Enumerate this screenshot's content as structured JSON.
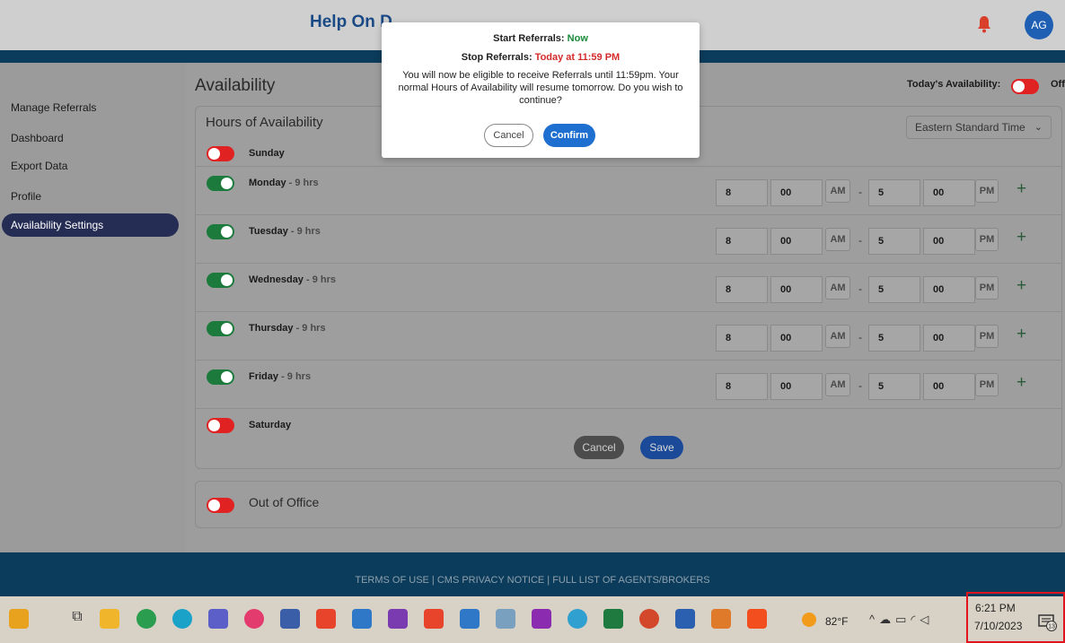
{
  "header": {
    "brand": "Help On D",
    "avatar_initials": "AG"
  },
  "sidebar": {
    "items": [
      {
        "label": "Manage Referrals"
      },
      {
        "label": "Dashboard"
      },
      {
        "label": "Export Data"
      },
      {
        "label": "Profile"
      },
      {
        "label": "Availability Settings"
      }
    ]
  },
  "main": {
    "title": "Availability",
    "today_label": "Today's Availability:",
    "today_state": "Off",
    "card_title": "Hours of Availability",
    "timezone": "Eastern Standard Time",
    "days": [
      {
        "name": "Sunday",
        "hrs": "",
        "enabled": false
      },
      {
        "name": "Monday",
        "hrs": " - 9 hrs",
        "enabled": true,
        "start_h": "8",
        "start_m": "00",
        "start_ap": "AM",
        "end_h": "5",
        "end_m": "00",
        "end_ap": "PM"
      },
      {
        "name": "Tuesday",
        "hrs": " - 9 hrs",
        "enabled": true,
        "start_h": "8",
        "start_m": "00",
        "start_ap": "AM",
        "end_h": "5",
        "end_m": "00",
        "end_ap": "PM"
      },
      {
        "name": "Wednesday",
        "hrs": " - 9 hrs",
        "enabled": true,
        "start_h": "8",
        "start_m": "00",
        "start_ap": "AM",
        "end_h": "5",
        "end_m": "00",
        "end_ap": "PM"
      },
      {
        "name": "Thursday",
        "hrs": " - 9 hrs",
        "enabled": true,
        "start_h": "8",
        "start_m": "00",
        "start_ap": "AM",
        "end_h": "5",
        "end_m": "00",
        "end_ap": "PM"
      },
      {
        "name": "Friday",
        "hrs": " - 9 hrs",
        "enabled": true,
        "start_h": "8",
        "start_m": "00",
        "start_ap": "AM",
        "end_h": "5",
        "end_m": "00",
        "end_ap": "PM"
      },
      {
        "name": "Saturday",
        "hrs": "",
        "enabled": false
      }
    ],
    "dash": "-",
    "plus": "+",
    "cancel_label": "Cancel",
    "save_label": "Save",
    "out_of_office_label": "Out of Office"
  },
  "footer": {
    "links_text": "TERMS OF USE | CMS PRIVACY NOTICE | FULL LIST OF AGENTS/BROKERS"
  },
  "modal": {
    "start_label": "Start Referrals: ",
    "start_value": "Now",
    "stop_label": "Stop Referrals: ",
    "stop_value": "Today at 11:59 PM",
    "message": "You will now be eligible to receive Referrals until 11:59pm. Your normal Hours of Availability will resume tomorrow. Do you wish to continue?",
    "cancel_label": "Cancel",
    "confirm_label": "Confirm"
  },
  "taskbar": {
    "temperature": "82°F",
    "time": "6:21 PM",
    "date": "7/10/2023",
    "notification_count": "13"
  },
  "colors": {
    "navy": "#0b3c5b",
    "toggle_on": "#1c7a3d",
    "toggle_off": "#e02222",
    "confirm_blue": "#1f6fd0"
  }
}
